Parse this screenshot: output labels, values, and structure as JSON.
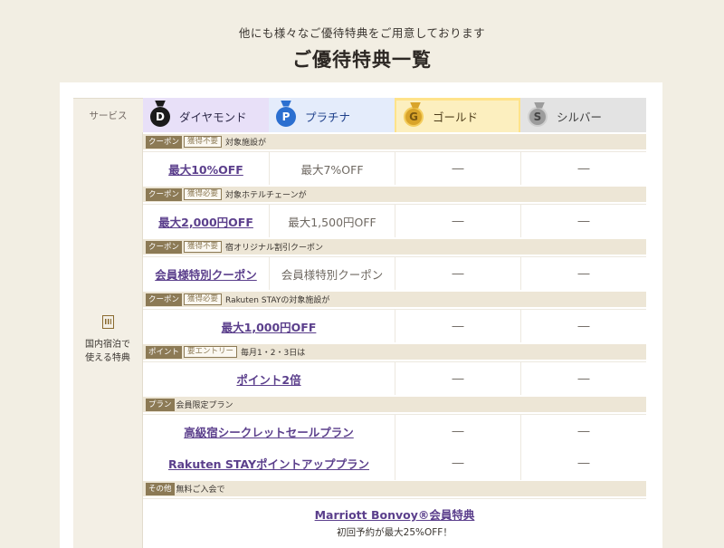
{
  "lead_text": "他にも様々なご優待特典をご用意しております",
  "heading": "ご優待特典一覧",
  "header": {
    "service_label": "サービス",
    "tiers": [
      {
        "name": "ダイヤモンド",
        "letter": "D",
        "icon": "diamond-medal-icon",
        "color": "#1b1b1b"
      },
      {
        "name": "プラチナ",
        "letter": "P",
        "icon": "platinum-medal-icon",
        "color": "#2b6fd0"
      },
      {
        "name": "ゴールド",
        "letter": "G",
        "icon": "gold-medal-icon",
        "color": "#d9a42a"
      },
      {
        "name": "シルバー",
        "letter": "S",
        "icon": "silver-medal-icon",
        "color": "#9c9c9c"
      }
    ]
  },
  "service": {
    "icon": "building-icon",
    "label_line1": "国内宿泊で",
    "label_line2": "使える特典"
  },
  "dash": "―",
  "sections": [
    {
      "type": "クーポン",
      "entry": "獲得不要",
      "desc": "対象施設が",
      "values": [
        "最大10%OFF",
        "最大7%OFF",
        "―",
        "―"
      ]
    },
    {
      "type": "クーポン",
      "entry": "獲得必要",
      "desc": "対象ホテルチェーンが",
      "values": [
        "最大2,000円OFF",
        "最大1,500円OFF",
        "―",
        "―"
      ]
    },
    {
      "type": "クーポン",
      "entry": "獲得不要",
      "desc": "宿オリジナル割引クーポン",
      "values": [
        "会員様特別クーポン",
        "会員様特別クーポン",
        "―",
        "―"
      ]
    },
    {
      "type": "クーポン",
      "entry": "獲得必要",
      "desc": "Rakuten STAYの対象施設が",
      "wide_value": "最大1,000円OFF",
      "values": [
        "―",
        "―"
      ]
    },
    {
      "type": "ポイント",
      "entry": "要エントリー",
      "desc": "毎月1・2・3日は",
      "wide_value": "ポイント2倍",
      "values": [
        "―",
        "―"
      ]
    },
    {
      "type": "プラン",
      "desc": "会員限定プラン",
      "rows": [
        {
          "wide_value": "高級宿シークレットセールプラン",
          "values": [
            "―",
            "―"
          ]
        },
        {
          "wide_value": "Rakuten STAYポイントアッププラン",
          "values": [
            "―",
            "―"
          ]
        }
      ]
    },
    {
      "type": "その他",
      "desc": "無料ご入会で",
      "full_value": "Marriott Bonvoy®会員特典",
      "full_sub": "初回予約が最大25%OFF！"
    }
  ]
}
